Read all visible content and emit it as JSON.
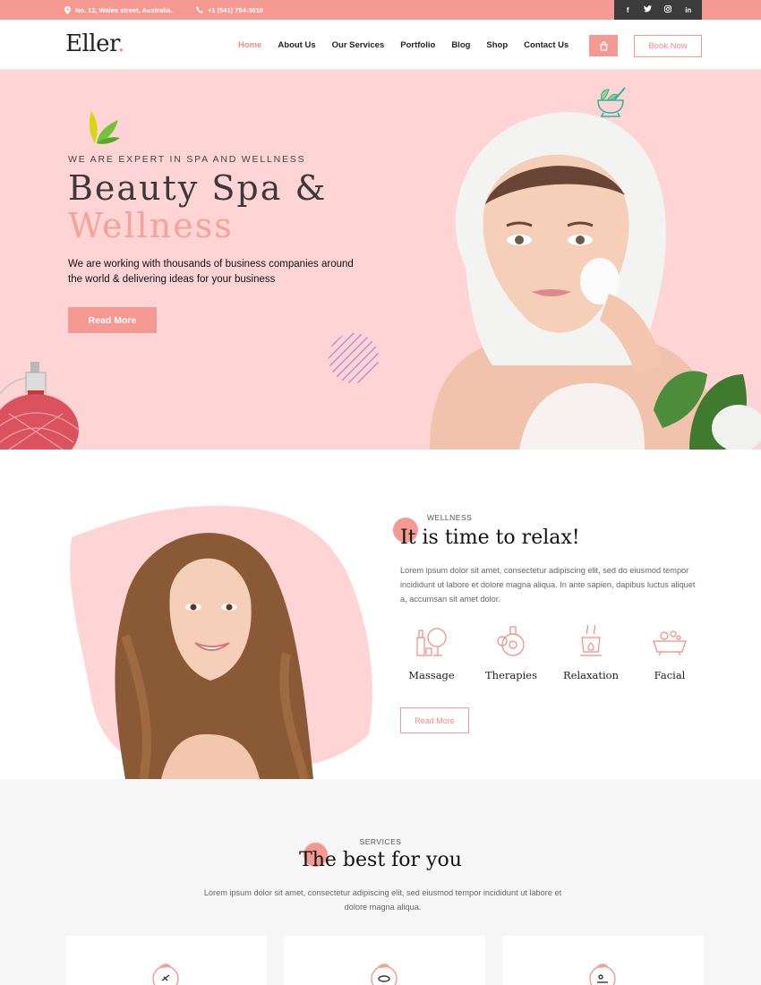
{
  "topbar": {
    "address": "No. 12, Wales street, Australia.",
    "phone": "+1 (541) 754-3010",
    "social": [
      "f",
      "t",
      "ig",
      "in"
    ]
  },
  "header": {
    "logo": "Eller",
    "logo_dot": ".",
    "nav": [
      "Home",
      "About Us",
      "Our Services",
      "Portfolio",
      "Blog",
      "Shop",
      "Contact Us"
    ],
    "active_nav": "Home",
    "book_label": "Book Now"
  },
  "hero": {
    "tagline": "WE ARE EXPERT IN SPA AND WELLNESS",
    "title_line1": "Beauty Spa &",
    "title_line2": "Wellness",
    "description": "We are working with thousands of business companies around the world & delivering ideas for your business",
    "button": "Read More"
  },
  "about": {
    "label": "WELLNESS",
    "title": "It is time to relax!",
    "paragraph": "Lorem ipsum dolor sit amet, consectetur adipiscing elit, sed do eiusmod tempor incididunt ut labore et dolore magna aliqua. In ante sapien, dapibus luctus aliquet a, accumsan sit amet dolor.",
    "features": [
      {
        "title": "Massage",
        "icon": "cosmetics-icon"
      },
      {
        "title": "Therapies",
        "icon": "bottles-icon"
      },
      {
        "title": "Relaxation",
        "icon": "aroma-lamp-icon"
      },
      {
        "title": "Facial",
        "icon": "bath-icon"
      }
    ],
    "button": "Read More"
  },
  "services": {
    "label": "SERVICES",
    "title": "The best for you",
    "paragraph": "Lorem ipsum dolor sit amet, consectetur adipiscing elit, sed eiusmod tempor incididunt ut labore et dolore magna aliqua."
  },
  "colors": {
    "accent": "#f59a93",
    "hero_bg": "#ffd4d4",
    "dark": "#3b3b3b"
  }
}
